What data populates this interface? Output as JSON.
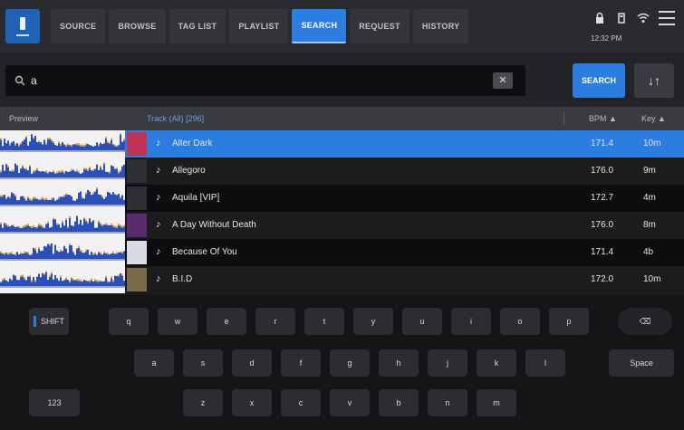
{
  "topbar": {
    "tabs": [
      {
        "label": "SOURCE",
        "active": false
      },
      {
        "label": "BROWSE",
        "active": false
      },
      {
        "label": "TAG LIST",
        "active": false
      },
      {
        "label": "PLAYLIST",
        "active": false
      },
      {
        "label": "SEARCH",
        "active": true
      },
      {
        "label": "REQUEST",
        "active": false
      },
      {
        "label": "HISTORY",
        "active": false
      }
    ],
    "status_text": "12:32 PM"
  },
  "search": {
    "query": "a",
    "clear_label": "✕",
    "search_button": "SEARCH",
    "sort_button": "↓↑"
  },
  "columns": {
    "preview": "Preview",
    "track": "Track (All) [296]",
    "bpm": "BPM ▲",
    "key": "Key ▲"
  },
  "tracks": [
    {
      "title": "Alter Dark",
      "bpm": "171.4",
      "key": "10m",
      "selected": true
    },
    {
      "title": "Allegoro",
      "bpm": "176.0",
      "key": "9m",
      "selected": false
    },
    {
      "title": "Aquila [VIP]",
      "bpm": "172.7",
      "key": "4m",
      "selected": false
    },
    {
      "title": "A Day Without Death",
      "bpm": "176.0",
      "key": "8m",
      "selected": false
    },
    {
      "title": "Because Of You",
      "bpm": "171.4",
      "key": "4b",
      "selected": false
    },
    {
      "title": "B.I.D",
      "bpm": "172.0",
      "key": "10m",
      "selected": false
    }
  ],
  "keyboard": {
    "row1": [
      "q",
      "w",
      "e",
      "r",
      "t",
      "y",
      "u",
      "i",
      "o",
      "p"
    ],
    "row2": [
      "a",
      "s",
      "d",
      "f",
      "g",
      "h",
      "j",
      "k",
      "l"
    ],
    "row3": [
      "z",
      "x",
      "c",
      "v",
      "b",
      "n",
      "m"
    ],
    "shift_label": "SHIFT",
    "backspace_label": "⌫",
    "space_label": "Space",
    "numbers_label": "123"
  },
  "colors": {
    "accent": "#2b7de0",
    "background": "#1a1a1d",
    "preview_bg": "#f2f2f4",
    "waveform_blue": "#2a4fb8",
    "waveform_orange": "#e8a53a"
  }
}
